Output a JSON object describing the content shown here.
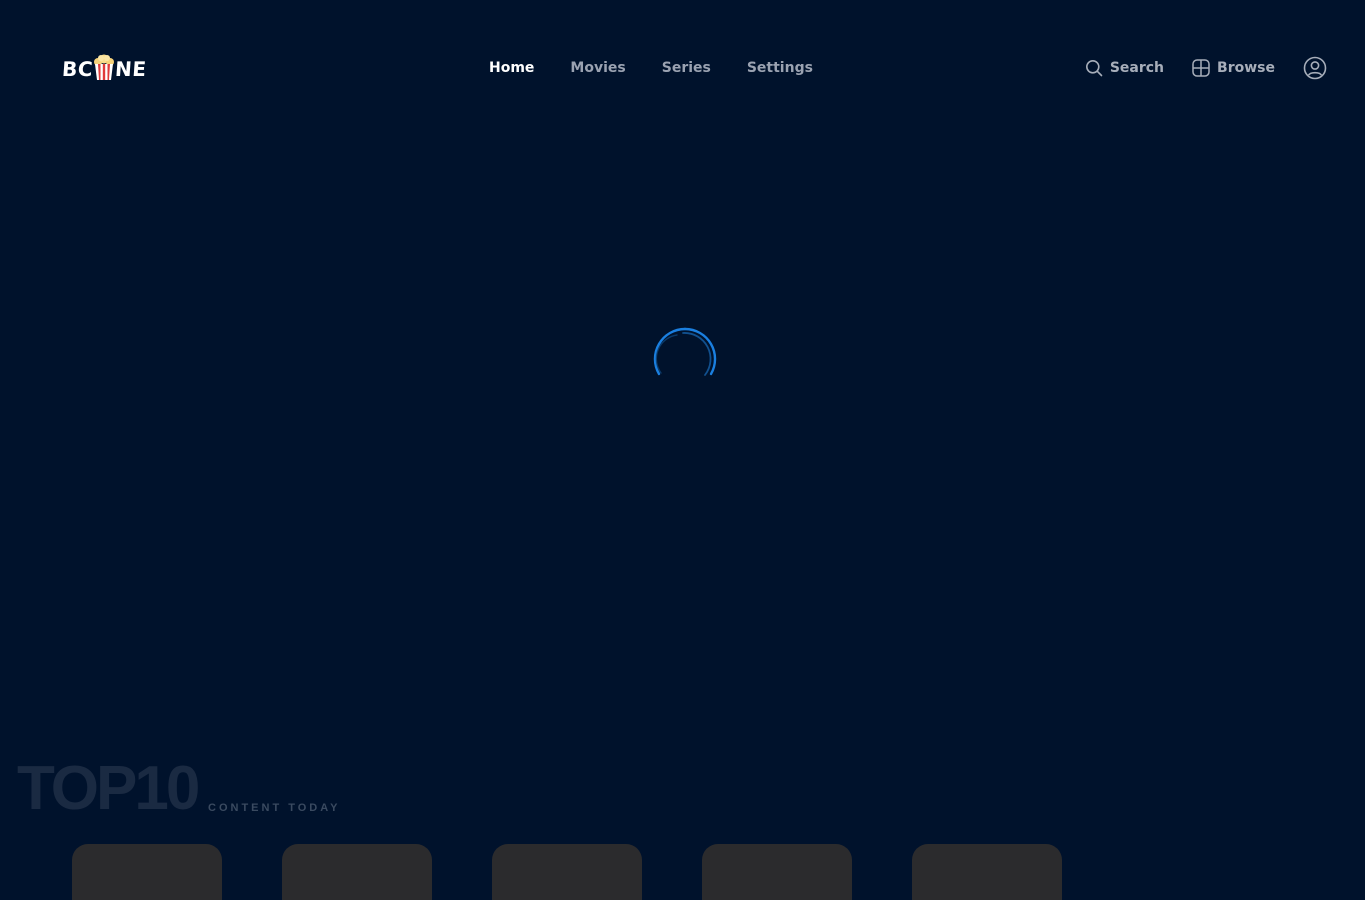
{
  "brand": {
    "logo_left": "BC",
    "logo_right": "NE",
    "accent_color": "#1a7fe0"
  },
  "nav": {
    "items": [
      {
        "label": "Home",
        "active": true
      },
      {
        "label": "Movies",
        "active": false
      },
      {
        "label": "Series",
        "active": false
      },
      {
        "label": "Settings",
        "active": false
      }
    ]
  },
  "actions": {
    "search_label": "Search",
    "search_icon": "search-icon",
    "browse_label": "Browse",
    "browse_icon": "grid-icon",
    "account_icon": "user-icon"
  },
  "loading": {
    "icon": "spinner-icon"
  },
  "top10": {
    "title": "TOP10",
    "subtitle": "CONTENT TODAY",
    "cards": [
      {
        "placeholder": true
      },
      {
        "placeholder": true
      },
      {
        "placeholder": true
      },
      {
        "placeholder": true
      },
      {
        "placeholder": true
      }
    ]
  }
}
